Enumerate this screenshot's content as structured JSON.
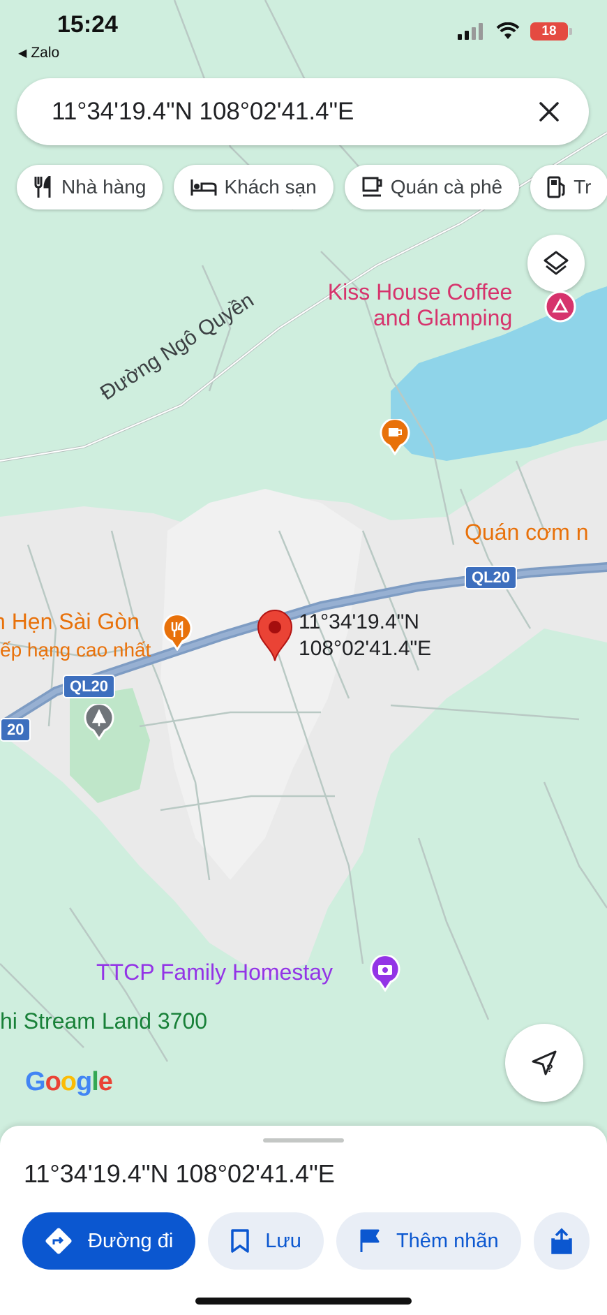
{
  "status_bar": {
    "time": "15:24",
    "back_app": "Zalo",
    "battery": "18"
  },
  "search": {
    "query": "11°34'19.4\"N 108°02'41.4\"E"
  },
  "chips": [
    {
      "label": "Nhà hàng",
      "icon": "restaurant-icon"
    },
    {
      "label": "Khách sạn",
      "icon": "hotel-icon"
    },
    {
      "label": "Quán cà phê",
      "icon": "coffee-icon"
    },
    {
      "label": "Tr",
      "icon": "gas-station-icon"
    }
  ],
  "map": {
    "places": {
      "kiss_house_line1": "Kiss House Coffee",
      "kiss_house_line2": "and Glamping",
      "quan_com": "Quán cơm n",
      "hen_saigon": "n Hẹn Sài Gòn",
      "hen_saigon_sub": "ếp hạng cao nhất",
      "ttcp": "TTCP Family Homestay",
      "stream_land": "hi Stream Land 3700"
    },
    "road_name": "Đường Ngô Quyền",
    "shield_right": "QL20",
    "shield_mid": "QL20",
    "shield_left": "20",
    "pin_lat": "11°34'19.4\"N",
    "pin_lng": "108°02'41.4\"E",
    "attribution": "Google",
    "colors": {
      "land": "#cfeede",
      "urban": "#ececec",
      "water": "#8fd4e9",
      "highway": "#7e9cc3",
      "pin": "#ea4335",
      "poi_pink": "#d6336c",
      "poi_orange": "#e8710a",
      "poi_purple": "#9334e6"
    }
  },
  "sheet": {
    "title": "11°34'19.4\"N 108°02'41.4\"E",
    "actions": [
      {
        "label": "Đường đi",
        "icon": "directions-icon"
      },
      {
        "label": "Lưu",
        "icon": "bookmark-icon"
      },
      {
        "label": "Thêm nhãn",
        "icon": "flag-icon"
      }
    ]
  }
}
